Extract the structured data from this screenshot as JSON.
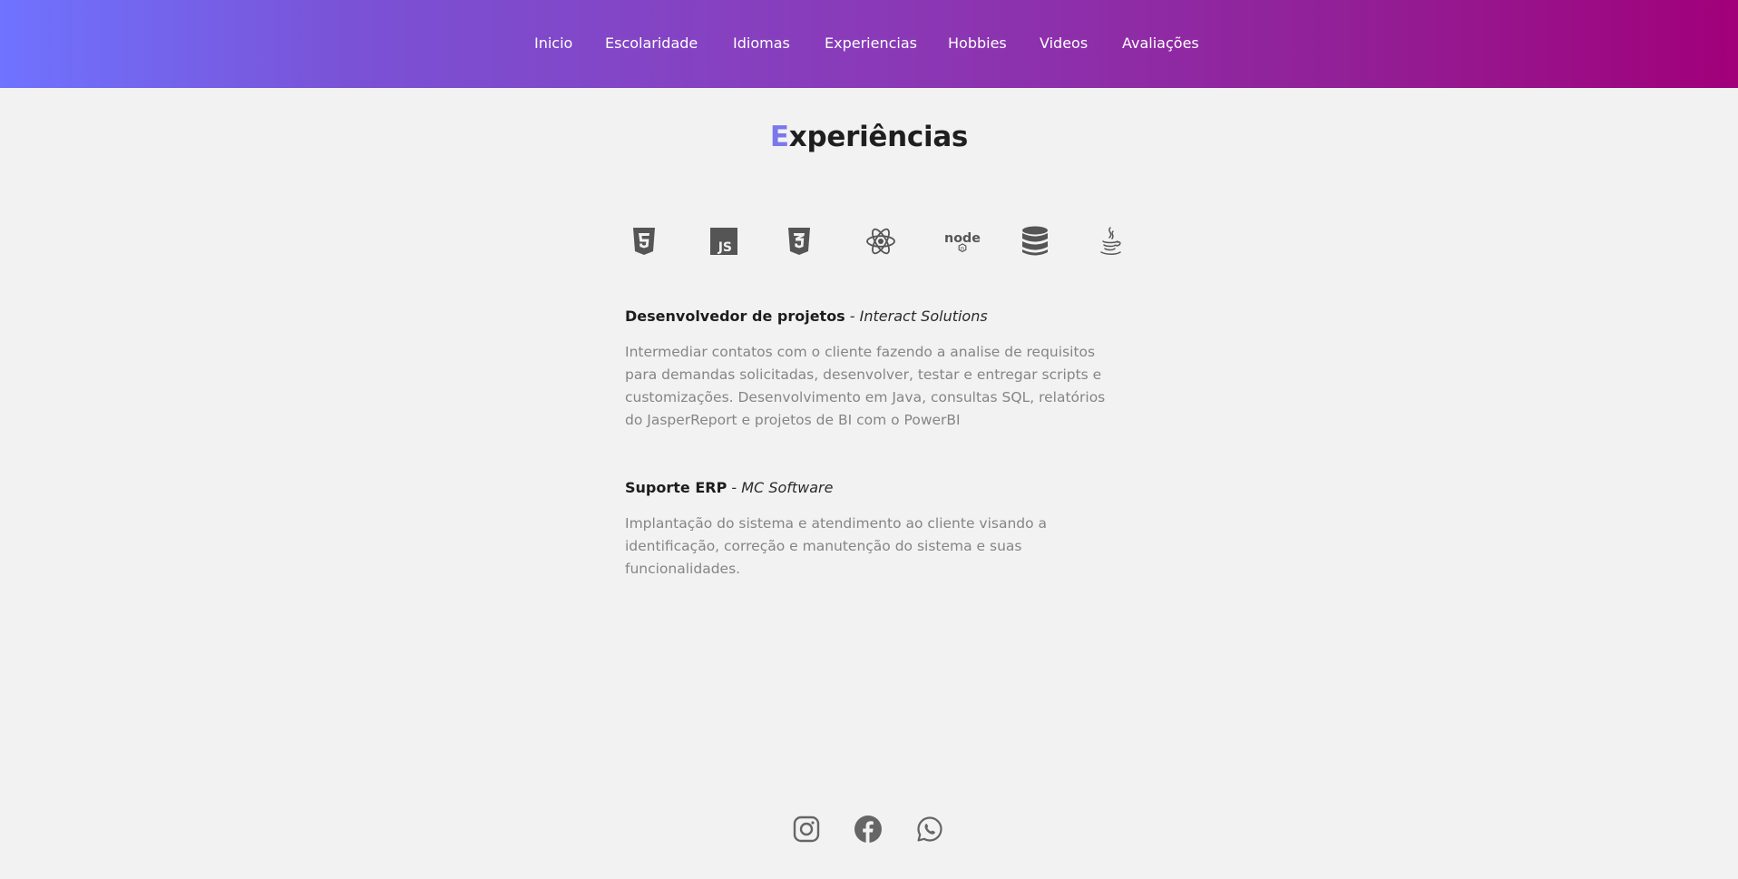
{
  "nav": {
    "items": [
      {
        "label": "Inicio"
      },
      {
        "label": "Escolaridade"
      },
      {
        "label": "Idiomas"
      },
      {
        "label": "Experiencias"
      },
      {
        "label": "Hobbies"
      },
      {
        "label": "Videos"
      },
      {
        "label": "Avaliações"
      }
    ]
  },
  "section": {
    "title_first": "E",
    "title_rest": "xperiências"
  },
  "techs": [
    {
      "icon": "html5-icon"
    },
    {
      "icon": "javascript-icon"
    },
    {
      "icon": "css3-icon"
    },
    {
      "icon": "react-icon"
    },
    {
      "icon": "nodejs-icon",
      "text": "node"
    },
    {
      "icon": "database-icon"
    },
    {
      "icon": "java-icon"
    }
  ],
  "jobs": [
    {
      "role": "Desenvolvedor de projetos",
      "separator": " - ",
      "company": "Interact Solutions",
      "description": "Intermediar contatos com o cliente fazendo a analise de requisitos para demandas solicitadas, desenvolver, testar e entregar scripts e customizações. Desenvolvimento em Java, consultas SQL, relatórios do JasperReport e projetos de BI com o PowerBI"
    },
    {
      "role": "Suporte ERP",
      "separator": " - ",
      "company": "MC Software",
      "description": "Implantação do sistema e atendimento ao cliente visando a identificação, correção e manutenção do sistema e suas funcionalidades."
    }
  ],
  "social": [
    {
      "icon": "instagram-icon"
    },
    {
      "icon": "facebook-icon"
    },
    {
      "icon": "whatsapp-icon"
    }
  ],
  "colors": {
    "gradient_start": "#6f73ff",
    "gradient_end": "#a1007a",
    "title_accent": "#7a78ea",
    "icon_gray": "#555555",
    "background": "#f2f2f2"
  }
}
